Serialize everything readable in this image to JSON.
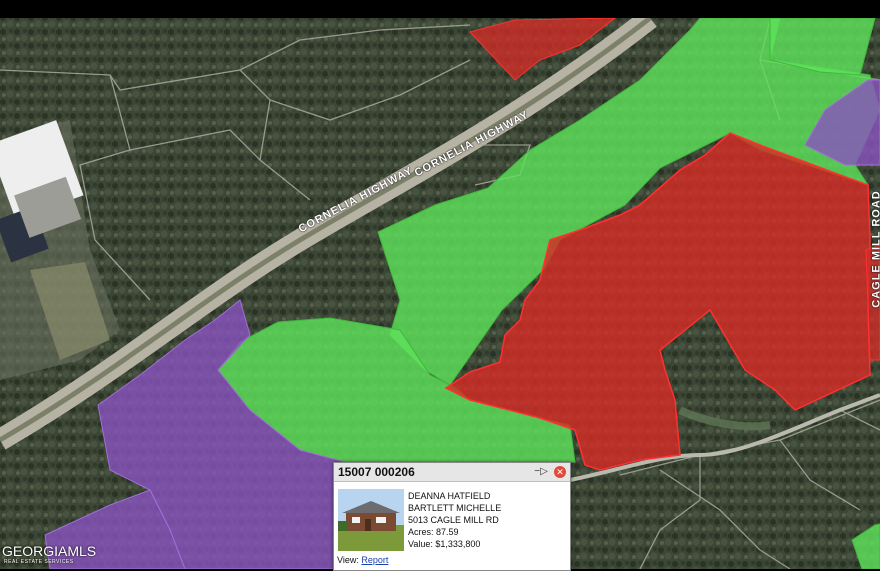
{
  "map": {
    "roads": [
      {
        "label": "CORNELIA HIGHWAY"
      },
      {
        "label": "CORNELIA HIGHWAY"
      },
      {
        "label": "CAGLE MILL ROAD"
      }
    ],
    "parcel_colors": {
      "red": "#d42c26",
      "green": "#5ee25a",
      "purple": "#8a52bf"
    }
  },
  "popup": {
    "title": "15007 000206",
    "owner1": "DEANNA HATFIELD",
    "owner2": "BARTLETT MICHELLE",
    "address": "5013 CAGLE MILL RD",
    "acres": "Acres: 87.59",
    "value": "Value: $1,333,800",
    "view_label": "View:",
    "report_link": "Report",
    "pin_icon": "pin-icon",
    "close_icon": "close-icon"
  },
  "logo": {
    "name": "GEORGIAMLS",
    "subtitle": "REAL ESTATE SERVICES"
  }
}
